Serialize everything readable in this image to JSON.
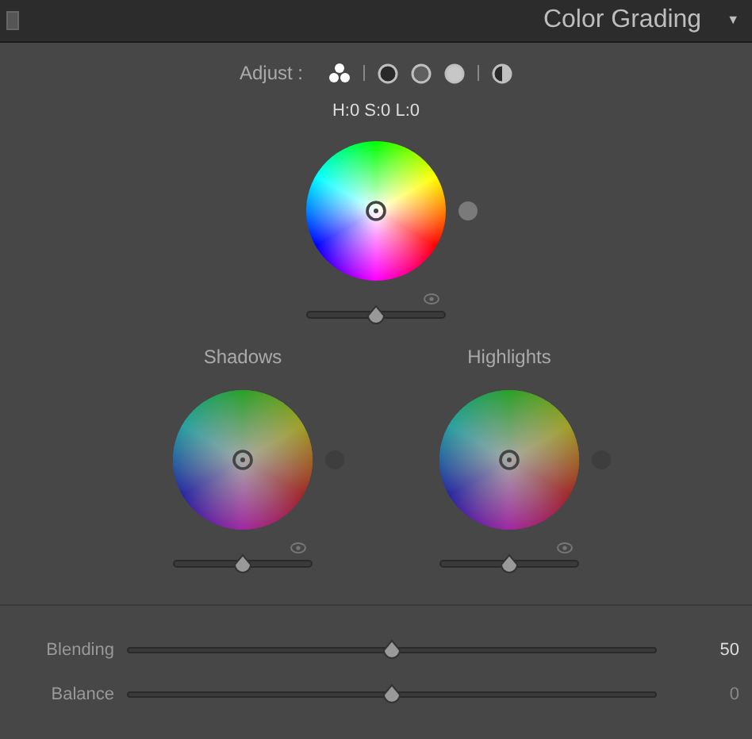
{
  "panel": {
    "title": "Color Grading",
    "collapse_glyph": "▼"
  },
  "adjust": {
    "label": "Adjust :",
    "modes": [
      {
        "kind": "three",
        "selected": true
      },
      {
        "kind": "shadows",
        "selected": false
      },
      {
        "kind": "midtones",
        "selected": false
      },
      {
        "kind": "highlights",
        "selected": false
      },
      {
        "kind": "global",
        "selected": false
      }
    ]
  },
  "readout": "H:0 S:0 L:0",
  "main_wheel": {
    "level": 0.5
  },
  "wheels": [
    {
      "label": "Shadows",
      "level": 0.5
    },
    {
      "label": "Highlights",
      "level": 0.5
    }
  ],
  "sliders": [
    {
      "label": "Blending",
      "level": 0.5,
      "value": "50",
      "emphasized": true
    },
    {
      "label": "Balance",
      "level": 0.5,
      "value": "0",
      "emphasized": false
    }
  ]
}
